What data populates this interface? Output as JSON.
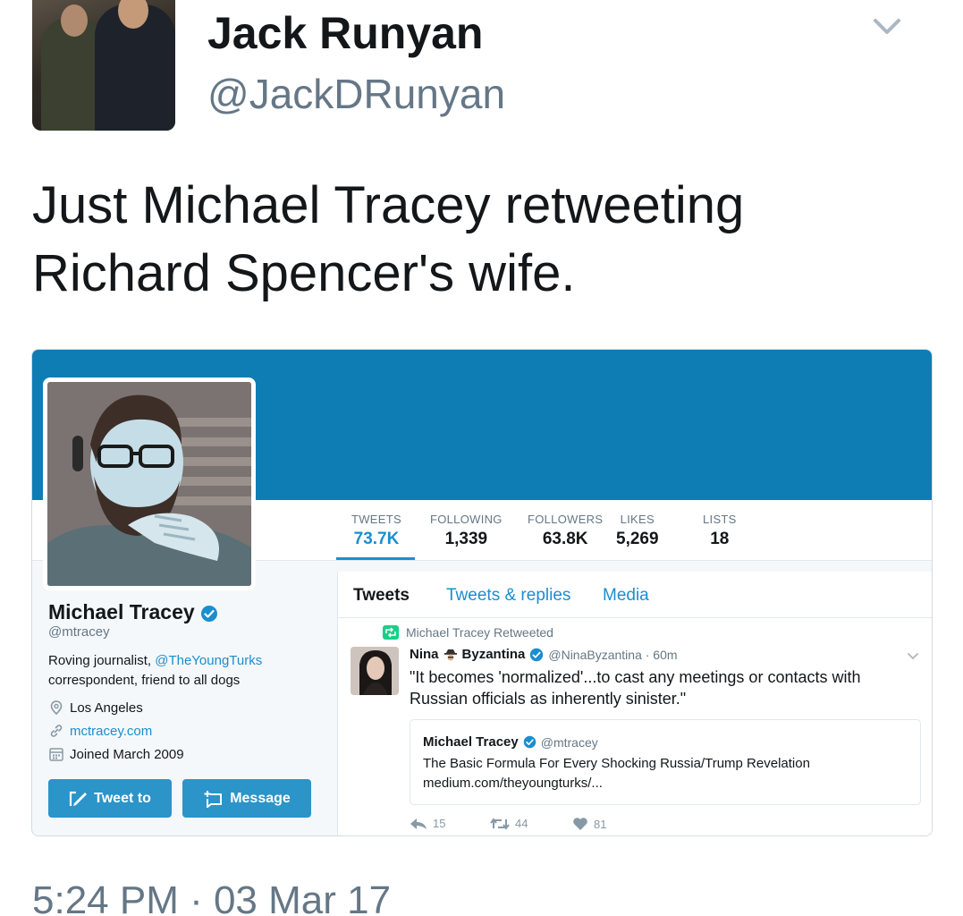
{
  "outer_tweet": {
    "name": "Jack Runyan",
    "handle": "@JackDRunyan",
    "text": "Just Michael Tracey retweeting Richard Spencer's wife.",
    "timestamp": "5:24 PM · 03 Mar 17"
  },
  "embedded": {
    "banner_color": "#0e7db4",
    "accent_color": "#1b8ecf",
    "stats": [
      {
        "label": "TWEETS",
        "value": "73.7K"
      },
      {
        "label": "FOLLOWING",
        "value": "1,339"
      },
      {
        "label": "FOLLOWERS",
        "value": "63.8K"
      },
      {
        "label": "LIKES",
        "value": "5,269"
      },
      {
        "label": "LISTS",
        "value": "18"
      }
    ],
    "profile": {
      "name": "Michael Tracey",
      "handle": "@mtracey",
      "bio_prefix": "Roving journalist, ",
      "bio_link": "@TheYoungTurks",
      "bio_suffix": "correspondent, friend to all dogs",
      "location": "Los Angeles",
      "website": "mctracey.com",
      "joined": "Joined March 2009"
    },
    "buttons": {
      "tweet_to": "Tweet to",
      "message": "Message"
    },
    "tabs": [
      "Tweets",
      "Tweets & replies",
      "Media"
    ],
    "timeline": {
      "retweet_label": "Michael Tracey Retweeted",
      "author_first": "Nina",
      "author_last": "Byzantina",
      "author_handle_time": "@NinaByzantina · 60m",
      "text": "\"It becomes 'normalized'...to cast any meetings or contacts with Russian officials as inherently sinister.\"",
      "quote": {
        "name": "Michael Tracey",
        "handle": "@mtracey",
        "title": "The Basic Formula For Every Shocking Russia/Trump Revelation",
        "url": "medium.com/theyoungturks/..."
      },
      "actions": {
        "replies": "15",
        "retweets": "44",
        "likes": "81"
      }
    }
  }
}
